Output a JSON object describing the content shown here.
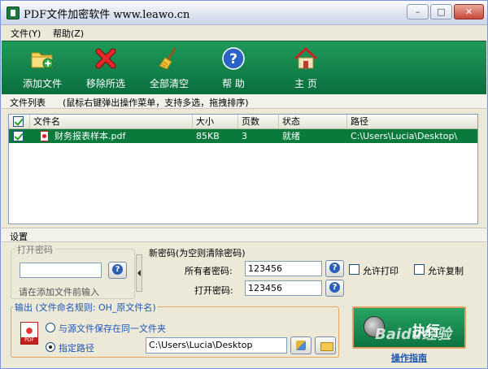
{
  "window": {
    "title": "PDF文件加密软件 www.leawo.cn",
    "controls": {
      "minimize": "–",
      "maximize": "□",
      "close": "✕"
    }
  },
  "menu": {
    "file": "文件(Y)",
    "help": "帮助(Z)"
  },
  "toolbar": {
    "add": "添加文件",
    "remove": "移除所选",
    "clear": "全部清空",
    "help": "帮 助",
    "home": "主 页"
  },
  "file_list": {
    "title": "文件列表",
    "hint": "(鼠标右键弹出操作菜单，支持多选，拖拽排序)",
    "columns": [
      "文件名",
      "大小",
      "页数",
      "状态",
      "路径"
    ],
    "rows": [
      {
        "checked": true,
        "name": "财务报表样本.pdf",
        "size": "85KB",
        "pages": "3",
        "status": "就绪",
        "path": "C:\\Users\\Lucia\\Desktop\\"
      }
    ]
  },
  "settings": {
    "title": "设置",
    "open_password": {
      "legend": "打开密码",
      "value": "",
      "note": "请在添加文件前输入"
    },
    "new_password": {
      "title": "新密码(为空则清除密码)",
      "owner_label": "所有者密码:",
      "owner_value": "123456",
      "open_label": "打开密码:",
      "open_value": "123456",
      "allow_print": "允许打印",
      "allow_copy": "允许复制"
    },
    "output": {
      "legend": "输出 (文件命名规则: OH_原文件名)",
      "option_same": "与源文件保存在同一文件夹",
      "option_path": "指定路径",
      "selected": "option_path",
      "path": "C:\\Users\\Lucia\\Desktop"
    }
  },
  "run": {
    "label": "执行",
    "watermark": "Baidu经验"
  },
  "guide_link": "操作指南"
}
